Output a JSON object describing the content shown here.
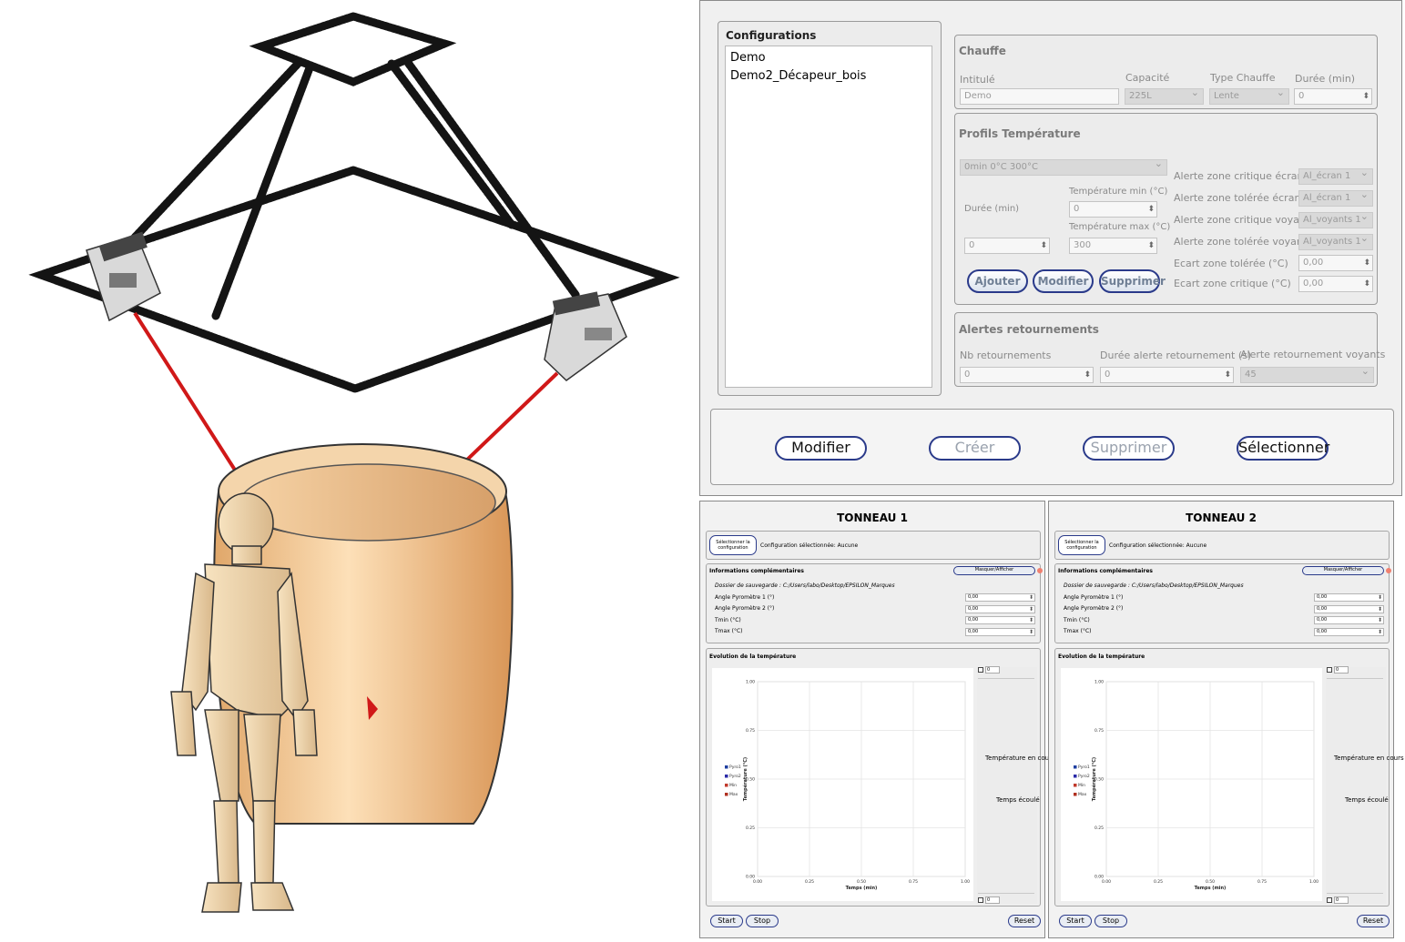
{
  "config": {
    "configurations_title": "Configurations",
    "list_items": [
      "Demo",
      "Demo2_Décapeur_bois"
    ],
    "chauffe": {
      "title": "Chauffe",
      "intitule_label": "Intitulé",
      "intitule_value": "Demo",
      "capacite_label": "Capacité",
      "capacite_value": "225L",
      "type_label": "Type Chauffe",
      "type_value": "Lente",
      "duree_label": "Durée (min)",
      "duree_value": "0"
    },
    "profils": {
      "title": "Profils Température",
      "profile_value": "0min 0°C 300°C",
      "duree_label": "Durée (min)",
      "duree_value": "0",
      "tmin_label": "Température min (°C)",
      "tmin_value": "0",
      "tmax_label": "Température max (°C)",
      "tmax_value": "300",
      "ajouter": "Ajouter",
      "modifier": "Modifier",
      "supprimer": "Supprimer",
      "alerts": [
        {
          "label": "Alerte zone critique écran",
          "value": "Al_écran 1"
        },
        {
          "label": "Alerte zone tolérée écran",
          "value": "Al_écran 1"
        },
        {
          "label": "Alerte zone critique voyants",
          "value": "Al_voyants 1"
        },
        {
          "label": "Alerte zone tolérée voyants",
          "value": "Al_voyants 1"
        },
        {
          "label": "Ecart zone tolérée (°C)",
          "value": "0,00"
        },
        {
          "label": "Ecart zone critique (°C)",
          "value": "0,00"
        }
      ]
    },
    "retournements": {
      "title": "Alertes retournements",
      "nb_label": "Nb retournements",
      "nb_value": "0",
      "duree_label": "Durée alerte retournement (s)",
      "duree_value": "0",
      "voyants_label": "Alerte retournement voyants",
      "voyants_value": "45"
    },
    "actions": {
      "modifier": "Modifier",
      "creer": "Créer",
      "supprimer": "Supprimer",
      "selectionner": "Sélectionner"
    }
  },
  "tonneaux": [
    {
      "title": "TONNEAU 1",
      "select_btn": "Sélectionner la configuration",
      "config_status": "Configuration sélectionnée: Aucune",
      "info_title": "Informations complémentaires",
      "mask_btn": "Masquer/Afficher",
      "dossier": "Dossier de sauvegarde : C:/Users/labo/Desktop/EPSILON_Marques",
      "fields": [
        {
          "label": "Angle Pyromètre 1 (°)",
          "value": "0,00"
        },
        {
          "label": "Angle Pyromètre 2 (°)",
          "value": "0,00"
        },
        {
          "label": "Tmin (°C)",
          "value": "0,00"
        },
        {
          "label": "Tmax (°C)",
          "value": "0,00"
        }
      ],
      "evolution_title": "Evolution de la température",
      "spin_top": "0",
      "spin_bottom": "0",
      "temp_en_cours": "Température en cours",
      "temps_ecoule": "Temps écoulé",
      "start": "Start",
      "stop": "Stop",
      "reset": "Reset"
    },
    {
      "title": "TONNEAU 2",
      "select_btn": "Sélectionner la configuration",
      "config_status": "Configuration sélectionnée: Aucune",
      "info_title": "Informations complémentaires",
      "mask_btn": "Masquer/Afficher",
      "dossier": "Dossier de sauvegarde : C:/Users/labo/Desktop/EPSILON_Marques",
      "fields": [
        {
          "label": "Angle Pyromètre 1 (°)",
          "value": "0,00"
        },
        {
          "label": "Angle Pyromètre 2 (°)",
          "value": "0,00"
        },
        {
          "label": "Tmin (°C)",
          "value": "0,00"
        },
        {
          "label": "Tmax (°C)",
          "value": "0,00"
        }
      ],
      "evolution_title": "Evolution de la température",
      "spin_top": "0",
      "spin_bottom": "0",
      "temp_en_cours": "Température en cours",
      "temps_ecoule": "Temps écoulé",
      "start": "Start",
      "stop": "Stop",
      "reset": "Reset"
    }
  ],
  "chart_data": [
    {
      "type": "line",
      "xlabel": "Temps (min)",
      "ylabel": "Température (°C)",
      "xlim": [
        0,
        1
      ],
      "ylim": [
        0,
        1
      ],
      "x_ticks": [
        "0.00",
        "0.25",
        "0.50",
        "0.75",
        "1.00"
      ],
      "y_ticks": [
        "0.00",
        "0.25",
        "0.50",
        "0.75",
        "1.00"
      ],
      "grid": true,
      "legend_position": "left",
      "series": [
        {
          "name": "Pyro1",
          "color": "#1f3fa0",
          "values": []
        },
        {
          "name": "Pyro2",
          "color": "#2a2aa8",
          "values": []
        },
        {
          "name": "Min",
          "color": "#c0392b",
          "values": []
        },
        {
          "name": "Max",
          "color": "#b03020",
          "values": []
        }
      ]
    },
    {
      "type": "line",
      "xlabel": "Temps (min)",
      "ylabel": "Température (°C)",
      "xlim": [
        0,
        1
      ],
      "ylim": [
        0,
        1
      ],
      "x_ticks": [
        "0.00",
        "0.25",
        "0.50",
        "0.75",
        "1.00"
      ],
      "y_ticks": [
        "0.00",
        "0.25",
        "0.50",
        "0.75",
        "1.00"
      ],
      "grid": true,
      "legend_position": "left",
      "series": [
        {
          "name": "Pyro1",
          "color": "#1f3fa0",
          "values": []
        },
        {
          "name": "Pyro2",
          "color": "#2a2aa8",
          "values": []
        },
        {
          "name": "Min",
          "color": "#c0392b",
          "values": []
        },
        {
          "name": "Max",
          "color": "#b03020",
          "values": []
        }
      ]
    }
  ]
}
